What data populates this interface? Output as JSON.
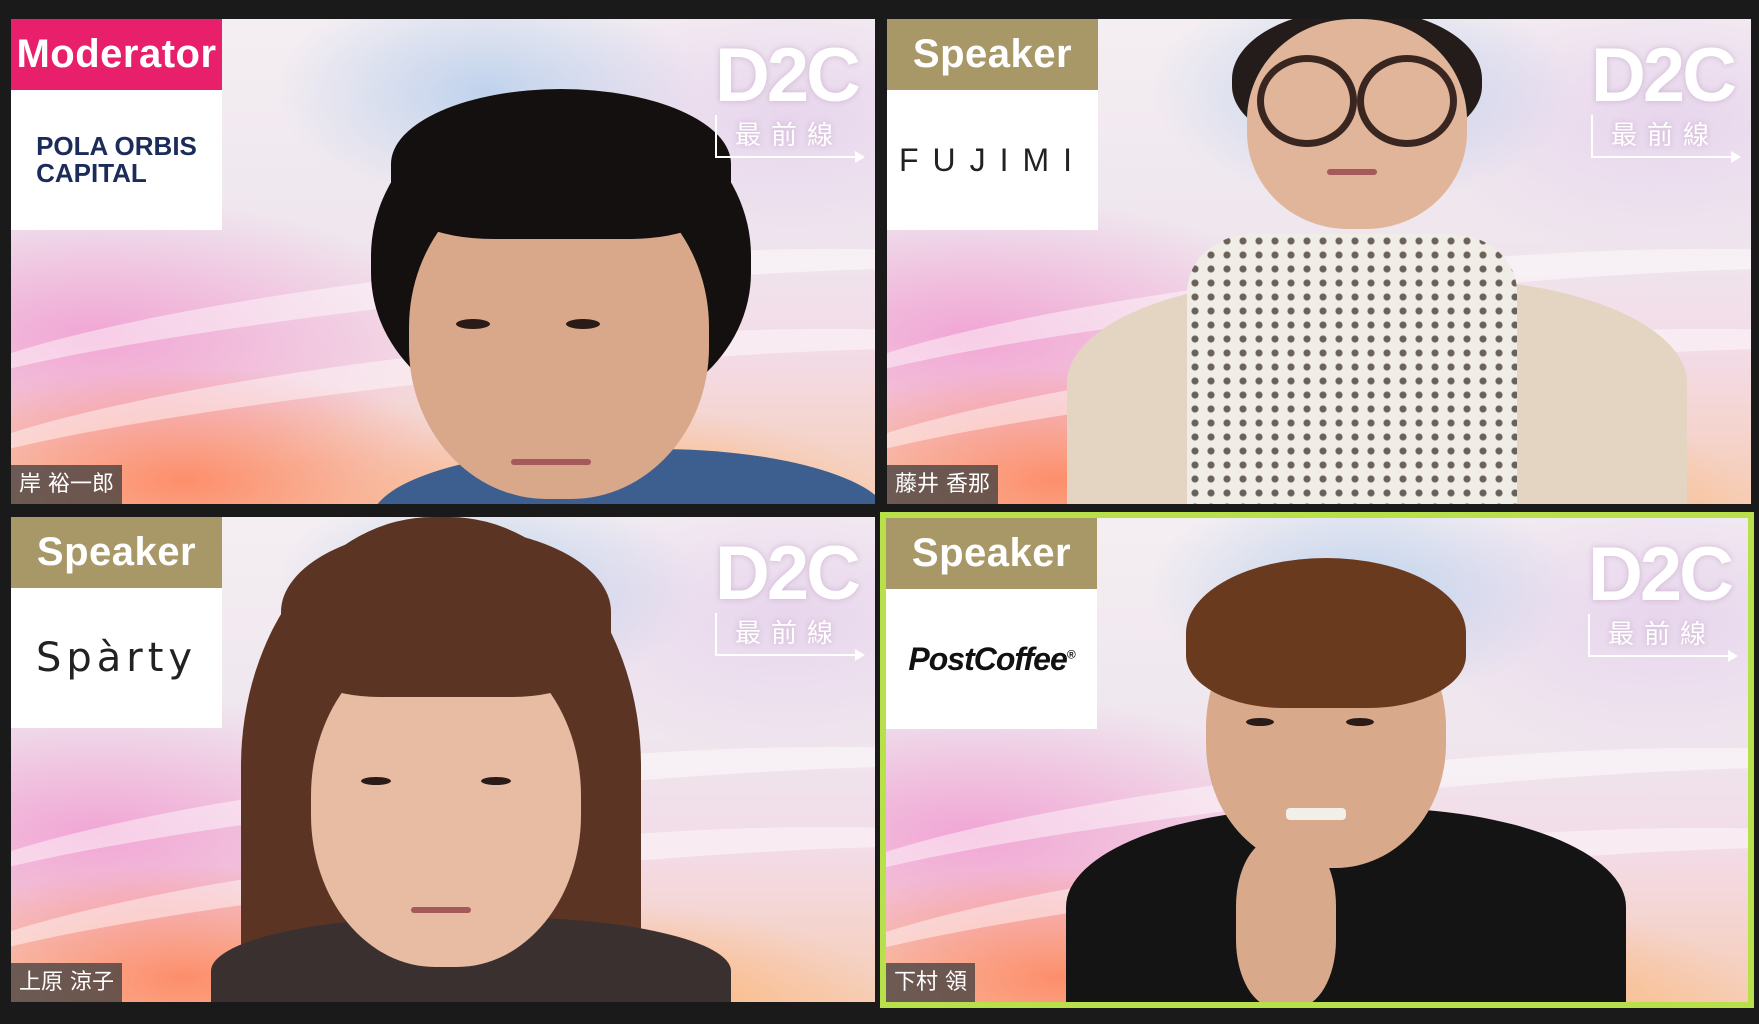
{
  "tiles": [
    {
      "role": "Moderator",
      "logo_line1": "POLA ORBIS",
      "logo_line2": "CAPITAL",
      "brand_main": "D2C",
      "brand_sub": "最前線",
      "name": "岸 裕一郎"
    },
    {
      "role": "Speaker",
      "logo": "FUJIMI",
      "brand_main": "D2C",
      "brand_sub": "最前線",
      "name": "藤井 香那"
    },
    {
      "role": "Speaker",
      "logo": "Spàrty",
      "brand_main": "D2C",
      "brand_sub": "最前線",
      "name": "上原 涼子"
    },
    {
      "role": "Speaker",
      "logo": "PostCoffee",
      "logo_mark": "®",
      "brand_main": "D2C",
      "brand_sub": "最前線",
      "name": "下村 領"
    }
  ],
  "colors": {
    "moderator_badge": "#e8206b",
    "speaker_badge": "#a89868",
    "active_speaker_border": "#b7e04a",
    "window_background": "#1a1a1a"
  }
}
